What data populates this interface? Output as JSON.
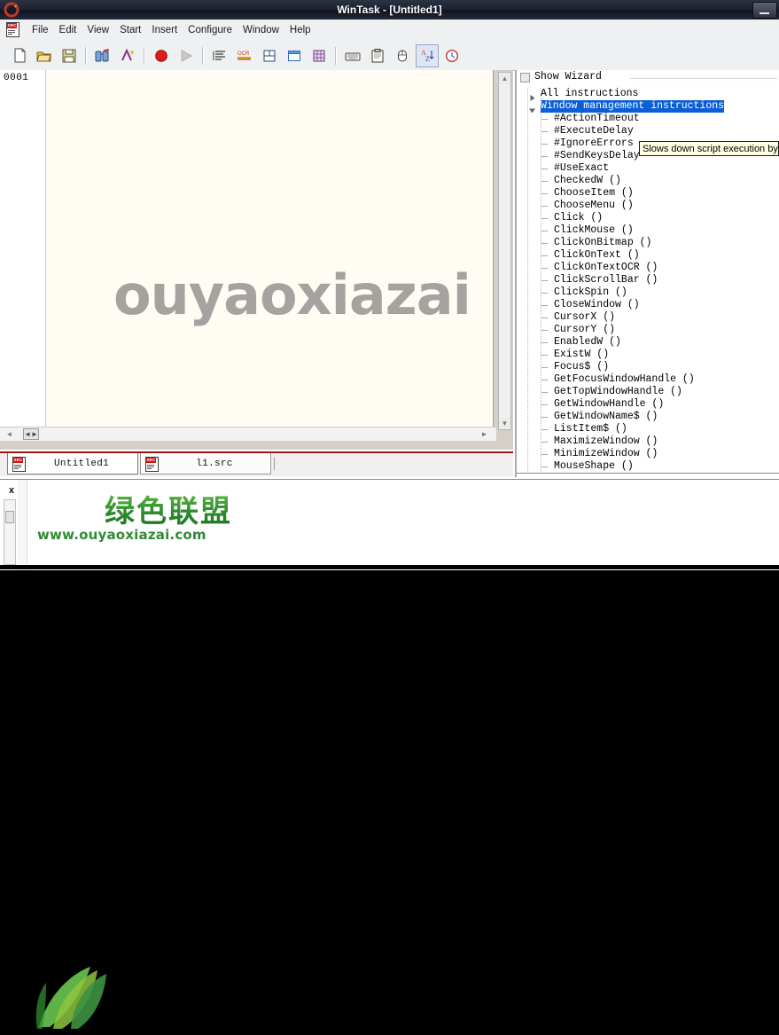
{
  "window": {
    "title": "WinTask - [Untitled1]",
    "app_icon": "wintask-logo-icon",
    "buttons": [
      {
        "name": "minimize-button",
        "glyph": "minimize-icon"
      }
    ]
  },
  "menubar": {
    "doc_icon": "src-document-icon",
    "items": [
      {
        "label": "File",
        "accel": "F"
      },
      {
        "label": "Edit",
        "accel": "E"
      },
      {
        "label": "View",
        "accel": "V"
      },
      {
        "label": "Start",
        "accel": "S"
      },
      {
        "label": "Insert",
        "accel": "I"
      },
      {
        "label": "Configure",
        "accel": "C"
      },
      {
        "label": "Window",
        "accel": "W"
      },
      {
        "label": "Help",
        "accel": "H"
      }
    ]
  },
  "toolbar": {
    "groups": [
      [
        {
          "name": "new-file-button",
          "icon": "new-document-icon",
          "enabled": true,
          "selected": false
        },
        {
          "name": "open-file-button",
          "icon": "open-folder-icon",
          "enabled": true,
          "selected": false
        },
        {
          "name": "save-file-button",
          "icon": "floppy-save-icon",
          "enabled": true,
          "selected": false
        }
      ],
      [
        {
          "name": "find-button",
          "icon": "binoculars-find-icon",
          "enabled": true,
          "selected": false
        },
        {
          "name": "find-next-button",
          "icon": "find-next-icon",
          "enabled": true,
          "selected": false
        }
      ],
      [
        {
          "name": "record-button",
          "icon": "record-red-circle-icon",
          "enabled": true,
          "selected": false
        },
        {
          "name": "run-button",
          "icon": "play-triangle-icon",
          "enabled": false,
          "selected": false
        }
      ],
      [
        {
          "name": "insert-text-button",
          "icon": "text-lines-icon",
          "enabled": true,
          "selected": false
        },
        {
          "name": "insert-ocr-button",
          "icon": "ocr-icon",
          "enabled": true,
          "selected": false
        },
        {
          "name": "insert-object-button",
          "icon": "object-frame-icon",
          "enabled": true,
          "selected": false
        },
        {
          "name": "insert-window-button",
          "icon": "window-icon",
          "enabled": true,
          "selected": false
        },
        {
          "name": "insert-bitmap-button",
          "icon": "bitmap-grid-icon",
          "enabled": true,
          "selected": false
        }
      ],
      [
        {
          "name": "keyboard-button",
          "icon": "keyboard-icon",
          "enabled": true,
          "selected": false
        },
        {
          "name": "clipboard-button",
          "icon": "clipboard-icon",
          "enabled": true,
          "selected": false
        },
        {
          "name": "mouse-button",
          "icon": "mouse-icon",
          "enabled": true,
          "selected": false
        },
        {
          "name": "sort-az-button",
          "icon": "sort-a-z-icon",
          "enabled": true,
          "selected": true
        },
        {
          "name": "timer-button",
          "icon": "clock-timer-icon",
          "enabled": true,
          "selected": false
        }
      ]
    ]
  },
  "editor": {
    "line_number": "0001",
    "content": "",
    "hscroll": {
      "left_arrow": "◄",
      "right_arrow": "►",
      "thumb_glyph": "◄►"
    },
    "vscroll": {
      "up_arrow": "▲",
      "down_arrow": "▼"
    }
  },
  "watermark": {
    "text": "ouyaoxiazai"
  },
  "doc_tabs": [
    {
      "label": "Untitled1",
      "icon": "src-document-icon",
      "active": true
    },
    {
      "label": "l1.src",
      "icon": "src-document-icon",
      "active": false
    }
  ],
  "output_panel": {
    "close_label": "x",
    "close_icon": "close-icon"
  },
  "logo": {
    "chinese": "绿色联盟",
    "url": "www.ouyaoxiazai.com",
    "leaf_icon": "green-leaves-icon"
  },
  "wizard": {
    "checkbox_label": "Show Wizard",
    "checkbox_checked": false,
    "tree": [
      {
        "label": "All instructions",
        "depth": 0,
        "expander": "collapsed",
        "selected": false
      },
      {
        "label": "Window management instructions",
        "depth": 0,
        "expander": "expanded",
        "selected": true
      },
      {
        "label": "#ActionTimeout",
        "depth": 1,
        "expander": "none",
        "selected": false
      },
      {
        "label": "#ExecuteDelay",
        "depth": 1,
        "expander": "none",
        "selected": false
      },
      {
        "label": "#IgnoreErrors",
        "depth": 1,
        "expander": "none",
        "selected": false
      },
      {
        "label": "#SendKeysDelay",
        "depth": 1,
        "expander": "none",
        "selected": false
      },
      {
        "label": "#UseExact",
        "depth": 1,
        "expander": "none",
        "selected": false
      },
      {
        "label": "CheckedW ()",
        "depth": 1,
        "expander": "none",
        "selected": false
      },
      {
        "label": "ChooseItem ()",
        "depth": 1,
        "expander": "none",
        "selected": false
      },
      {
        "label": "ChooseMenu ()",
        "depth": 1,
        "expander": "none",
        "selected": false
      },
      {
        "label": "Click ()",
        "depth": 1,
        "expander": "none",
        "selected": false
      },
      {
        "label": "ClickMouse ()",
        "depth": 1,
        "expander": "none",
        "selected": false
      },
      {
        "label": "ClickOnBitmap ()",
        "depth": 1,
        "expander": "none",
        "selected": false
      },
      {
        "label": "ClickOnText ()",
        "depth": 1,
        "expander": "none",
        "selected": false
      },
      {
        "label": "ClickOnTextOCR ()",
        "depth": 1,
        "expander": "none",
        "selected": false
      },
      {
        "label": "ClickScrollBar ()",
        "depth": 1,
        "expander": "none",
        "selected": false
      },
      {
        "label": "ClickSpin ()",
        "depth": 1,
        "expander": "none",
        "selected": false
      },
      {
        "label": "CloseWindow ()",
        "depth": 1,
        "expander": "none",
        "selected": false
      },
      {
        "label": "CursorX ()",
        "depth": 1,
        "expander": "none",
        "selected": false
      },
      {
        "label": "CursorY ()",
        "depth": 1,
        "expander": "none",
        "selected": false
      },
      {
        "label": "EnabledW ()",
        "depth": 1,
        "expander": "none",
        "selected": false
      },
      {
        "label": "ExistW ()",
        "depth": 1,
        "expander": "none",
        "selected": false
      },
      {
        "label": "Focus$ ()",
        "depth": 1,
        "expander": "none",
        "selected": false
      },
      {
        "label": "GetFocusWindowHandle ()",
        "depth": 1,
        "expander": "none",
        "selected": false
      },
      {
        "label": "GetTopWindowHandle ()",
        "depth": 1,
        "expander": "none",
        "selected": false
      },
      {
        "label": "GetWindowHandle ()",
        "depth": 1,
        "expander": "none",
        "selected": false
      },
      {
        "label": "GetWindowName$ ()",
        "depth": 1,
        "expander": "none",
        "selected": false
      },
      {
        "label": "ListItem$ ()",
        "depth": 1,
        "expander": "none",
        "selected": false
      },
      {
        "label": "MaximizeWindow ()",
        "depth": 1,
        "expander": "none",
        "selected": false
      },
      {
        "label": "MinimizeWindow ()",
        "depth": 1,
        "expander": "none",
        "selected": false
      },
      {
        "label": "MouseShape ()",
        "depth": 1,
        "expander": "none",
        "selected": false
      }
    ]
  },
  "tooltip": {
    "text": "Slows down script execution by i"
  },
  "colors": {
    "titlebar": "#1b2130",
    "selection": "#0a5fd8",
    "tooltip_bg": "#ffffe1",
    "tab_accent": "#9a1616",
    "record_red": "#e01b1b",
    "logo_green": "#2f8f2f",
    "editor_bg": "#fffdf3"
  }
}
